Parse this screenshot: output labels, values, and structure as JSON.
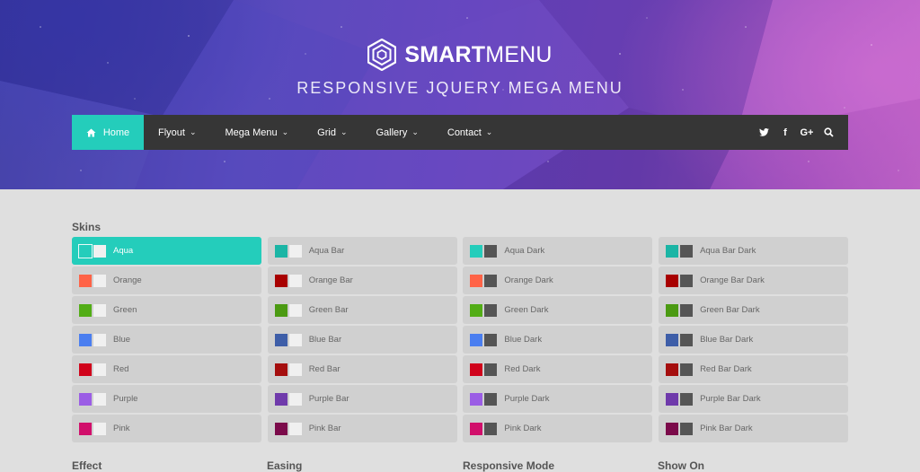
{
  "header": {
    "brand_bold": "SMART",
    "brand_light": "MENU",
    "tagline": "RESPONSIVE JQUERY MEGA MENU",
    "logo_icon": "hexagon-logo-icon"
  },
  "nav": {
    "items": [
      {
        "label": "Home",
        "icon": "home-icon",
        "active": true
      },
      {
        "label": "Flyout",
        "caret": "⌄"
      },
      {
        "label": "Mega Menu",
        "caret": "⌄"
      },
      {
        "label": "Grid",
        "caret": "⌄"
      },
      {
        "label": "Gallery",
        "caret": "⌄"
      },
      {
        "label": "Contact",
        "caret": "⌄"
      }
    ],
    "social": [
      {
        "icon": "twitter-icon"
      },
      {
        "icon": "facebook-icon",
        "glyph": "f"
      },
      {
        "icon": "google-plus-icon",
        "glyph": "G+"
      },
      {
        "icon": "search-icon"
      }
    ],
    "accent_color": "#24cdbb",
    "bar_color": "#363636"
  },
  "skins": {
    "title": "Skins",
    "columns": [
      [
        {
          "label": "Aqua",
          "color": "#24cdbb",
          "second": "#f0f0f0",
          "active": true
        },
        {
          "label": "Orange",
          "color": "#ff6347",
          "second": "#f0f0f0"
        },
        {
          "label": "Green",
          "color": "#52ad16",
          "second": "#f0f0f0"
        },
        {
          "label": "Blue",
          "color": "#4a7ef0",
          "second": "#f0f0f0"
        },
        {
          "label": "Red",
          "color": "#d0021b",
          "second": "#f0f0f0"
        },
        {
          "label": "Purple",
          "color": "#9b5de5",
          "second": "#f0f0f0"
        },
        {
          "label": "Pink",
          "color": "#d10f6b",
          "second": "#f0f0f0"
        }
      ],
      [
        {
          "label": "Aqua Bar",
          "color": "#1bb5a5",
          "second": "#f0f0f0"
        },
        {
          "label": "Orange Bar",
          "color": "#a80000",
          "second": "#f0f0f0"
        },
        {
          "label": "Green Bar",
          "color": "#4b9a12",
          "second": "#f0f0f0"
        },
        {
          "label": "Blue Bar",
          "color": "#3e5ea8",
          "second": "#f0f0f0"
        },
        {
          "label": "Red Bar",
          "color": "#a50e0e",
          "second": "#f0f0f0"
        },
        {
          "label": "Purple Bar",
          "color": "#6f3aab",
          "second": "#f0f0f0"
        },
        {
          "label": "Pink Bar",
          "color": "#7b0a4a",
          "second": "#f0f0f0"
        }
      ],
      [
        {
          "label": "Aqua Dark",
          "color": "#24cdbb",
          "second": "#555555"
        },
        {
          "label": "Orange Dark",
          "color": "#ff6347",
          "second": "#555555"
        },
        {
          "label": "Green Dark",
          "color": "#52ad16",
          "second": "#555555"
        },
        {
          "label": "Blue Dark",
          "color": "#4a7ef0",
          "second": "#555555"
        },
        {
          "label": "Red Dark",
          "color": "#d0021b",
          "second": "#555555"
        },
        {
          "label": "Purple Dark",
          "color": "#9b5de5",
          "second": "#555555"
        },
        {
          "label": "Pink Dark",
          "color": "#d10f6b",
          "second": "#555555"
        }
      ],
      [
        {
          "label": "Aqua Bar Dark",
          "color": "#1bb5a5",
          "second": "#555555"
        },
        {
          "label": "Orange Bar Dark",
          "color": "#a80000",
          "second": "#555555"
        },
        {
          "label": "Green Bar Dark",
          "color": "#4b9a12",
          "second": "#555555"
        },
        {
          "label": "Blue Bar Dark",
          "color": "#3e5ea8",
          "second": "#555555"
        },
        {
          "label": "Red Bar Dark",
          "color": "#a50e0e",
          "second": "#555555"
        },
        {
          "label": "Purple Bar Dark",
          "color": "#6f3aab",
          "second": "#555555"
        },
        {
          "label": "Pink Bar Dark",
          "color": "#7b0a4a",
          "second": "#555555"
        }
      ]
    ]
  },
  "bottom_sections": [
    {
      "title": "Effect"
    },
    {
      "title": "Easing"
    },
    {
      "title": "Responsive Mode"
    },
    {
      "title": "Show On"
    }
  ]
}
